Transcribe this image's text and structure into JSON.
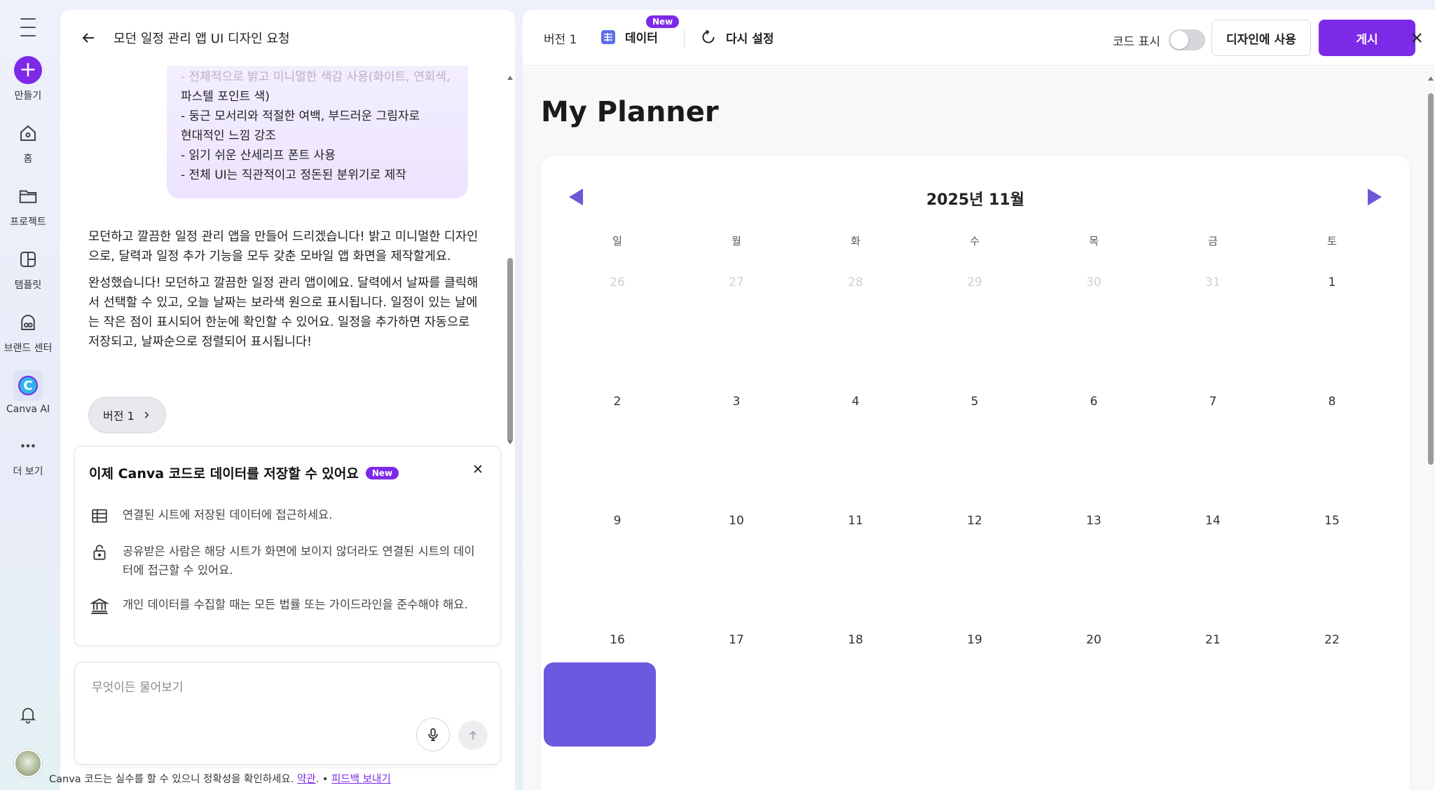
{
  "sidebar": {
    "items": [
      {
        "label": "만들기",
        "icon": "plus-icon"
      },
      {
        "label": "홈",
        "icon": "home-icon"
      },
      {
        "label": "프로젝트",
        "icon": "folder-icon"
      },
      {
        "label": "템플릿",
        "icon": "template-icon"
      },
      {
        "label": "브랜드 센터",
        "icon": "brand-icon"
      },
      {
        "label": "Canva AI",
        "icon": "canva-ai-icon"
      },
      {
        "label": "더 보기",
        "icon": "more-icon"
      }
    ]
  },
  "chat": {
    "title": "모던 일정 관리 앱 UI 디자인 요청",
    "user_message_lines": [
      "- 전체적으로 밝고 미니멀한 색감 사용(화이트, 연회색,",
      "파스텔 포인트 색)",
      "- 둥근 모서리와 적절한 여백, 부드러운 그림자로",
      "현대적인 느낌 강조",
      "- 읽기 쉬운 산세리프 폰트 사용",
      "- 전체 UI는 직관적이고 정돈된 분위기로 제작"
    ],
    "assistant_messages": [
      "모던하고 깔끔한 일정 관리 앱을 만들어 드리겠습니다! 밝고 미니멀한 디자인으로, 달력과 일정 추가 기능을 모두 갖춘 모바일 앱 화면을 제작할게요.",
      "완성했습니다! 모던하고 깔끔한 일정 관리 앱이에요. 달력에서 날짜를 클릭해서 선택할 수 있고, 오늘 날짜는 보라색 원으로 표시됩니다. 일정이 있는 날에는 작은 점이 표시되어 한눈에 확인할 수 있어요. 일정을 추가하면 자동으로 저장되고, 날짜순으로 정렬되어 표시됩니다!"
    ],
    "version_chip": "버전 1"
  },
  "notice": {
    "title": "이제 Canva 코드로 데이터를 저장할 수 있어요",
    "badge": "New",
    "rows": [
      {
        "icon": "table-icon",
        "text": "연결된 시트에 저장된 데이터에 접근하세요."
      },
      {
        "icon": "lock-icon",
        "text": "공유받은 사람은 해당 시트가 화면에 보이지 않더라도 연결된 시트의 데이터에 접근할 수 있어요."
      },
      {
        "icon": "bank-icon",
        "text": "개인 데이터를 수집할 때는 모든 법률 또는 가이드라인을 준수해야 해요."
      }
    ]
  },
  "input": {
    "placeholder": "무엇이든 물어보기",
    "value": ""
  },
  "disclaimer": {
    "text": "Canva 코드는 실수를 할 수 있으니 정확성을 확인하세요.",
    "terms_link": "약관",
    "separator": ". •",
    "feedback_link": "피드백 보내기"
  },
  "toolbar": {
    "version": "버전 1",
    "data_label": "데이터",
    "data_badge": "New",
    "reset_label": "다시 설정",
    "code_toggle_label": "코드 표시",
    "code_toggle_on": false,
    "use_in_design": "디자인에 사용",
    "publish": "게시"
  },
  "planner": {
    "title": "My Planner",
    "month": "2025년 11월",
    "weekdays": [
      "일",
      "월",
      "화",
      "수",
      "목",
      "금",
      "토"
    ],
    "days": [
      {
        "d": "26",
        "muted": true
      },
      {
        "d": "27",
        "muted": true
      },
      {
        "d": "28",
        "muted": true
      },
      {
        "d": "29",
        "muted": true
      },
      {
        "d": "30",
        "muted": true
      },
      {
        "d": "31",
        "muted": true
      },
      {
        "d": "1",
        "muted": false
      },
      {
        "d": "2",
        "muted": false
      },
      {
        "d": "3",
        "muted": false
      },
      {
        "d": "4",
        "muted": false
      },
      {
        "d": "5",
        "muted": false
      },
      {
        "d": "6",
        "muted": false
      },
      {
        "d": "7",
        "muted": false
      },
      {
        "d": "8",
        "muted": false
      },
      {
        "d": "9",
        "muted": false
      },
      {
        "d": "10",
        "muted": false
      },
      {
        "d": "11",
        "muted": false
      },
      {
        "d": "12",
        "muted": false
      },
      {
        "d": "13",
        "muted": false
      },
      {
        "d": "14",
        "muted": false
      },
      {
        "d": "15",
        "muted": false
      },
      {
        "d": "16",
        "muted": false
      },
      {
        "d": "17",
        "muted": false
      },
      {
        "d": "18",
        "muted": false
      },
      {
        "d": "19",
        "muted": false
      },
      {
        "d": "20",
        "muted": false
      },
      {
        "d": "21",
        "muted": false
      },
      {
        "d": "22",
        "muted": false
      }
    ]
  },
  "colors": {
    "accent": "#7d2ae8",
    "calendar_accent": "#6a5ad8"
  }
}
